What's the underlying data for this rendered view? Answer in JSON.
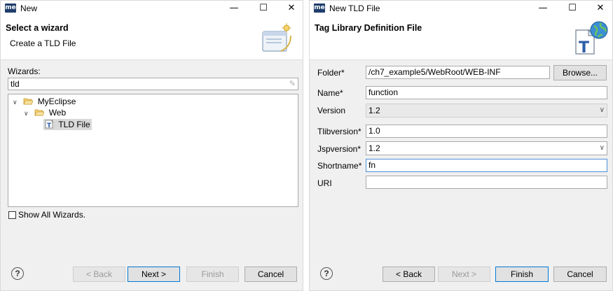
{
  "left_window": {
    "app_icon_text": "me",
    "title": "New",
    "header_title": "Select a wizard",
    "header_desc": "Create a TLD File",
    "wizards_label": "Wizards:",
    "filter_value": "tld",
    "tree": [
      {
        "label": "MyEclipse",
        "icon": "folder-open-icon",
        "expanded": true
      },
      {
        "label": "Web",
        "icon": "folder-open-icon",
        "expanded": true
      },
      {
        "label": "TLD File",
        "icon": "tld-file-icon",
        "selected": true
      }
    ],
    "show_all_label": "Show All Wizards.",
    "buttons": {
      "back": "< Back",
      "next": "Next >",
      "finish": "Finish",
      "cancel": "Cancel"
    }
  },
  "right_window": {
    "app_icon_text": "me",
    "title": "New TLD File",
    "header_title": "Tag Library Definition File",
    "fields": {
      "folder": {
        "label": "Folder*",
        "value": "/ch7_example5/WebRoot/WEB-INF"
      },
      "browse_label": "Browse...",
      "name": {
        "label": "Name*",
        "value": "function"
      },
      "version": {
        "label": "Version",
        "value": "1.2"
      },
      "tlibversion": {
        "label": "Tlibversion*",
        "value": "1.0"
      },
      "jspversion": {
        "label": "Jspversion*",
        "value": "1.2"
      },
      "shortname": {
        "label": "Shortname*",
        "value": "fn"
      },
      "uri": {
        "label": "URI",
        "value": ""
      }
    },
    "buttons": {
      "back": "< Back",
      "next": "Next >",
      "finish": "Finish",
      "cancel": "Cancel"
    }
  },
  "icons": {
    "minimize": "minimize-icon",
    "maximize": "maximize-icon",
    "close": "close-icon",
    "help": "help-icon"
  }
}
